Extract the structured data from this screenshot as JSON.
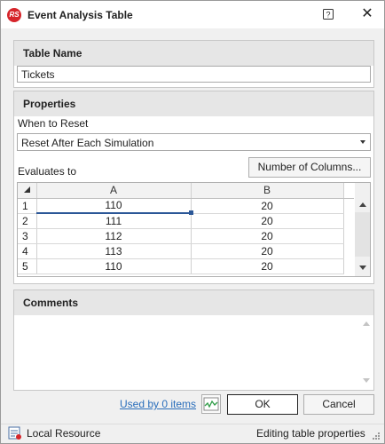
{
  "window": {
    "title": "Event Analysis Table",
    "logo_text": "RS",
    "help_label": "?",
    "close_label": "✕"
  },
  "table_name_panel": {
    "header": "Table Name",
    "value": "Tickets"
  },
  "properties_panel": {
    "header": "Properties",
    "when_to_reset_label": "When to Reset",
    "reset_selected": "Reset After Each Simulation",
    "evaluates_to_label": "Evaluates to",
    "number_of_columns_button": "Number of Columns..."
  },
  "grid": {
    "columns": [
      "A",
      "B"
    ],
    "rows": [
      {
        "num": "1",
        "a": "110",
        "b": "20"
      },
      {
        "num": "2",
        "a": "111",
        "b": "20"
      },
      {
        "num": "3",
        "a": "112",
        "b": "20"
      },
      {
        "num": "4",
        "a": "113",
        "b": "20"
      },
      {
        "num": "5",
        "a": "110",
        "b": "20"
      }
    ]
  },
  "comments_panel": {
    "header": "Comments",
    "value": ""
  },
  "footer": {
    "used_by_link": "Used by 0 items",
    "ok_button": "OK",
    "cancel_button": "Cancel"
  },
  "statusbar": {
    "resource_label": "Local Resource",
    "status_text": "Editing table properties"
  },
  "colors": {
    "accent_selection": "#2b5797",
    "logo_red": "#d6252b",
    "link_blue": "#2a6ebb"
  }
}
